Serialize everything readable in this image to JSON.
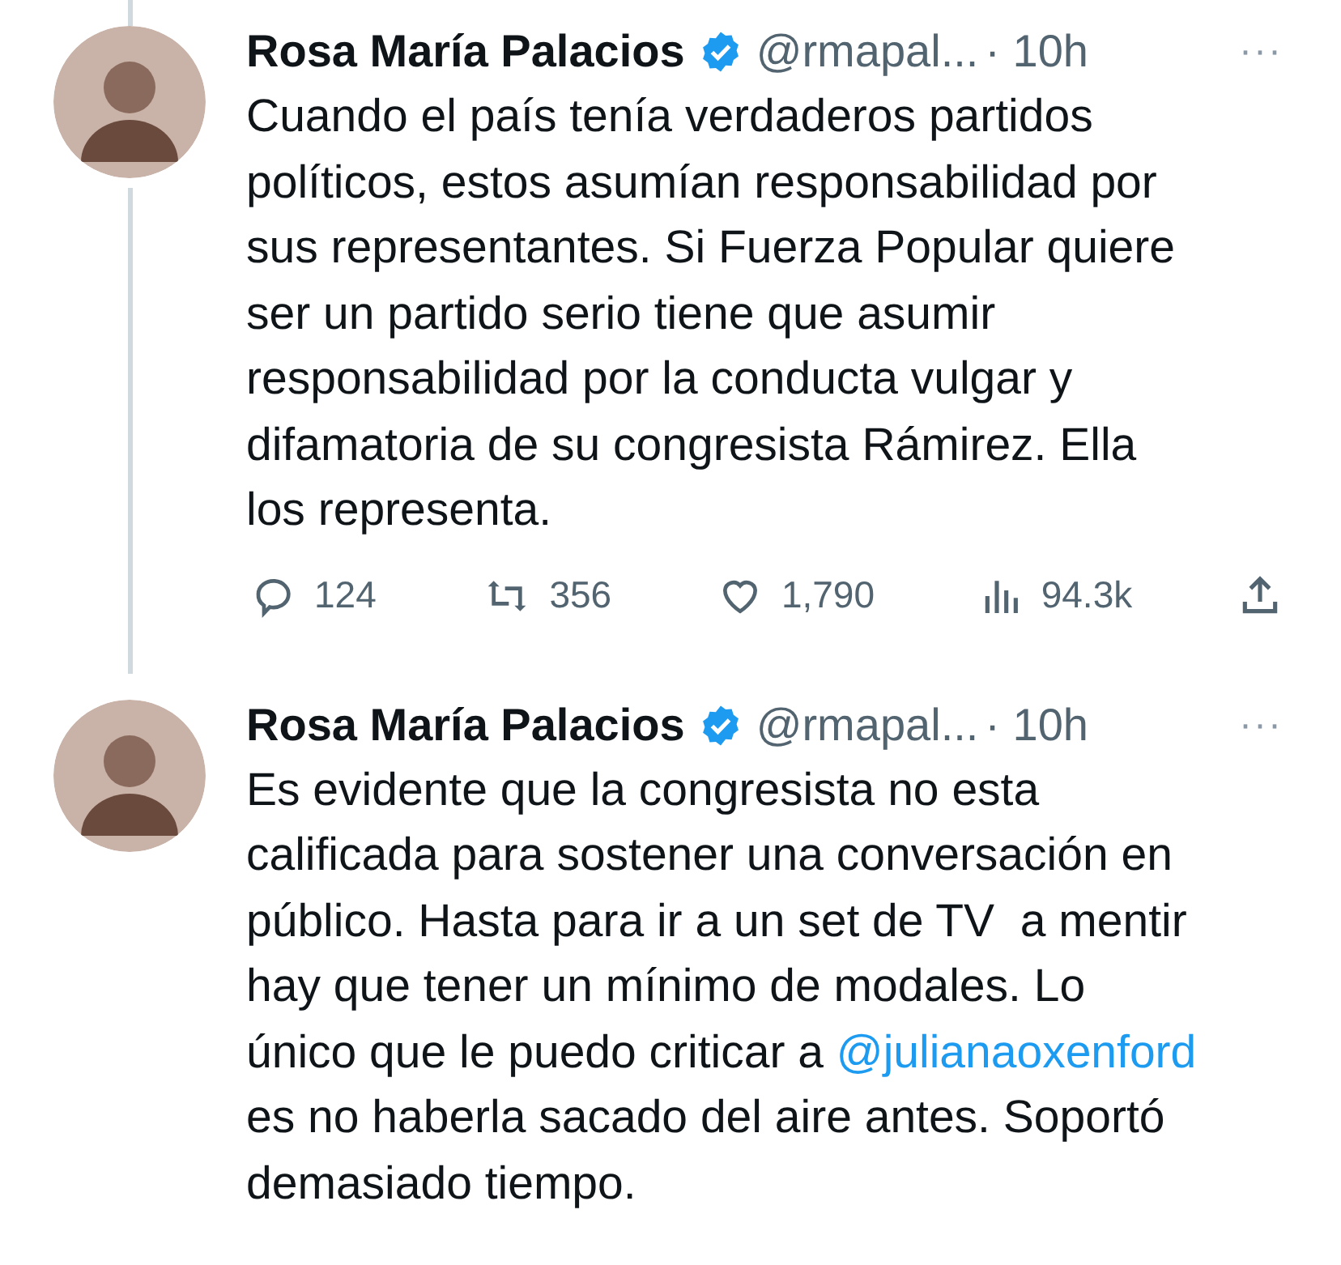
{
  "tweets": [
    {
      "name": "Rosa María Palacios",
      "verified": true,
      "handle": "@rmapal...",
      "time": "· 10h",
      "more": "···",
      "connected_above": true,
      "connected_below": true,
      "text": [
        {
          "kind": "text",
          "text": "Cuando el país tenía verdaderos partidos políticos, estos asumían responsabilidad por sus representantes. Si Fuerza Popular quiere ser un partido serio tiene que asumir responsabilidad por la conducta vulgar y difamatoria de su congresista Rámirez. Ella los representa."
        }
      ],
      "actions": [
        {
          "kind": "reply",
          "count": "124"
        },
        {
          "kind": "retweet",
          "count": "356"
        },
        {
          "kind": "like",
          "count": "1,790"
        },
        {
          "kind": "views",
          "count": "94.3k"
        },
        {
          "kind": "share"
        }
      ]
    },
    {
      "name": "Rosa María Palacios",
      "verified": true,
      "handle": "@rmapal...",
      "time": "· 10h",
      "more": "···",
      "text": [
        {
          "kind": "text",
          "text": "Es evidente que la congresista no esta calificada para sostener una conversación en público. Hasta para ir a un set de TV  a mentir hay que tener un mínimo de modales. Lo único que le puedo criticar a "
        },
        {
          "kind": "mention",
          "text": "@julianaoxenford"
        },
        {
          "kind": "text",
          "text": " es no haberla sacado del aire antes. Soportó demasiado tiempo."
        }
      ]
    }
  ]
}
